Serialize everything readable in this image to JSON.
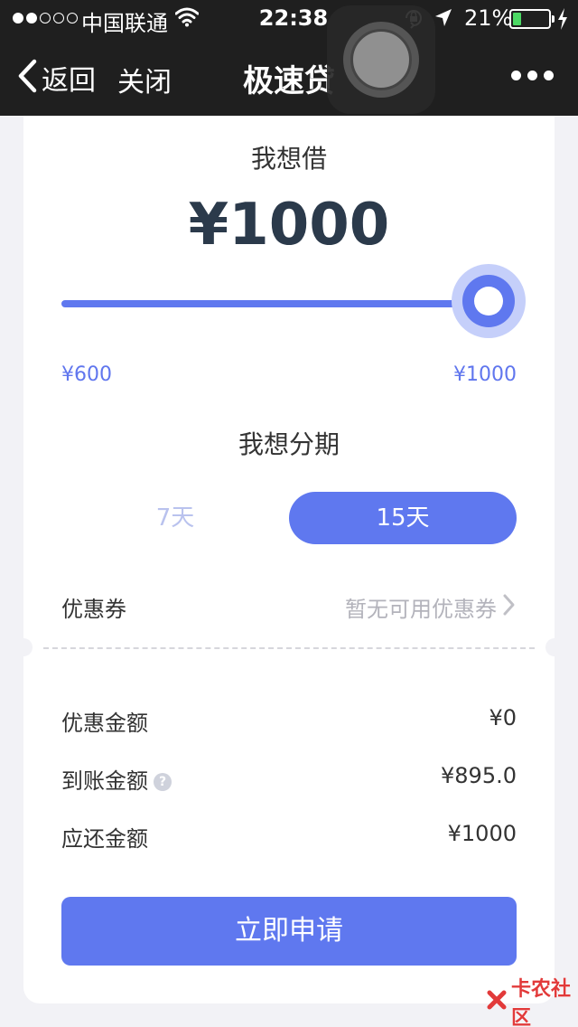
{
  "status_bar": {
    "carrier": "中国联通",
    "time": "22:38",
    "battery_percent": "21%",
    "battery_level": 0.21,
    "signal_bars_filled": 2,
    "signal_bars_total": 5,
    "icons": [
      "wifi-icon",
      "orientation-lock-icon",
      "location-arrow-icon",
      "battery-icon",
      "charging-bolt-icon"
    ]
  },
  "nav": {
    "back_label": "返回",
    "close_label": "关闭",
    "title": "极速贷",
    "more_icon": "more-dots-icon"
  },
  "loan": {
    "borrow_label": "我想借",
    "amount": "¥1000",
    "slider": {
      "min_label": "¥600",
      "max_label": "¥1000",
      "value": 1000,
      "min": 600,
      "max": 1000
    },
    "installment_label": "我想分期",
    "terms": [
      {
        "label": "7天",
        "selected": false
      },
      {
        "label": "15天",
        "selected": true
      }
    ],
    "coupon": {
      "label": "优惠券",
      "value": "暂无可用优惠券"
    }
  },
  "summary": {
    "discount_label": "优惠金额",
    "discount_value": "¥0",
    "received_label": "到账金额",
    "received_value": "¥895.0",
    "repay_label": "应还金额",
    "repay_value": "¥1000"
  },
  "apply_button": "立即申请",
  "watermark": "卡农社区",
  "colors": {
    "accent": "#5f78ef",
    "accent_light": "#c5cffa",
    "topbar": "#1f1f1f",
    "background": "#f2f2f6",
    "watermark": "#e23a3a"
  }
}
